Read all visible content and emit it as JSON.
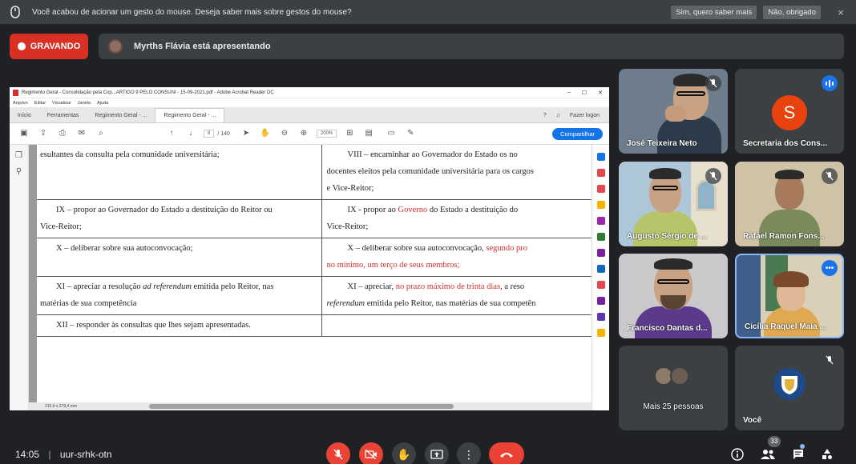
{
  "notification": {
    "message": "Você acabou de acionar um gesto do mouse. Deseja saber mais sobre gestos do mouse?",
    "yes_label": "Sim, quero saber mais",
    "no_label": "Não, obrigado",
    "close_glyph": "×"
  },
  "recording": {
    "label": "GRAVANDO"
  },
  "presenting": {
    "text": "Myrths Flávia está apresentando"
  },
  "acrobat": {
    "window_title": "Regimento Geral - Consolidação pela Cop...ARTIGO 9 PELO CONSUNI - 15-09-2021.pdf - Adobe Acrobat Reader DC",
    "menu": [
      "Arquivo",
      "Editar",
      "Visualizar",
      "Janela",
      "Ajuda"
    ],
    "tabs": [
      "Início",
      "Ferramentas",
      "Regimento Geral - ...",
      "Regimento Geral - ..."
    ],
    "login_label": "Fazer logon",
    "page_current": "8",
    "page_total": "/ 140",
    "zoom": "200%",
    "share_label": "Compartilhar",
    "page_size": "215,9 x 279,4 mm",
    "rows": [
      {
        "left": "esultantes da consulta pela comunidade universitária;",
        "right": [
          "VIII – encaminhar ao Governador do Estado os no",
          "docentes eleitos pela comunidade universitária para os cargos",
          "e Vice-Reitor;"
        ]
      },
      {
        "left": "IX – propor ao Governador do Estado a destituição do Reitor ou",
        "left2": "Vice-Reitor;",
        "right_a": "IX - propor ao ",
        "right_red": "Governo",
        "right_b": " do Estado a destituição do",
        "right2": "Vice-Reitor;"
      },
      {
        "left": "X – deliberar sobre sua autoconvocação;",
        "right_a": "X – deliberar sobre sua autoconvocação, ",
        "right_red": "segundo pro",
        "right2_red": "no mínimo, um terço de seus membros;"
      },
      {
        "left_a": "XI – apreciar a resolução ",
        "left_i": "ad referendum",
        "left_b": " emitida pelo Reitor, nas",
        "left2": "matérias de sua competência",
        "right_a": "XI – apreciar, ",
        "right_red": "no prazo máximo de trinta dias",
        "right_b": ", a reso",
        "right2_i": "referendum",
        "right2_b": " emitida pelo Reitor, nas matérias de sua competên"
      },
      {
        "left": "XII – responder às consultas que lhes sejam apresentadas.",
        "right": ""
      }
    ]
  },
  "participants": [
    {
      "name": "José Teixeira Neto",
      "muted": true
    },
    {
      "name": "Secretaria dos Cons...",
      "initial": "S",
      "speaking": true
    },
    {
      "name": "Augusto Sérgio de ...",
      "muted": true
    },
    {
      "name": "Rafael Ramon Fons...",
      "muted": true
    },
    {
      "name": "Francisco Dantas d...",
      "muted": false
    },
    {
      "name": "Cicília Raquel Maia ...",
      "more": true
    },
    {
      "name": "Mais 25 pessoas"
    },
    {
      "name": "Você",
      "muted": true
    }
  ],
  "bottom": {
    "time": "14:05",
    "separator": "|",
    "meeting_code": "uur-srhk-otn",
    "people_count": "33"
  }
}
